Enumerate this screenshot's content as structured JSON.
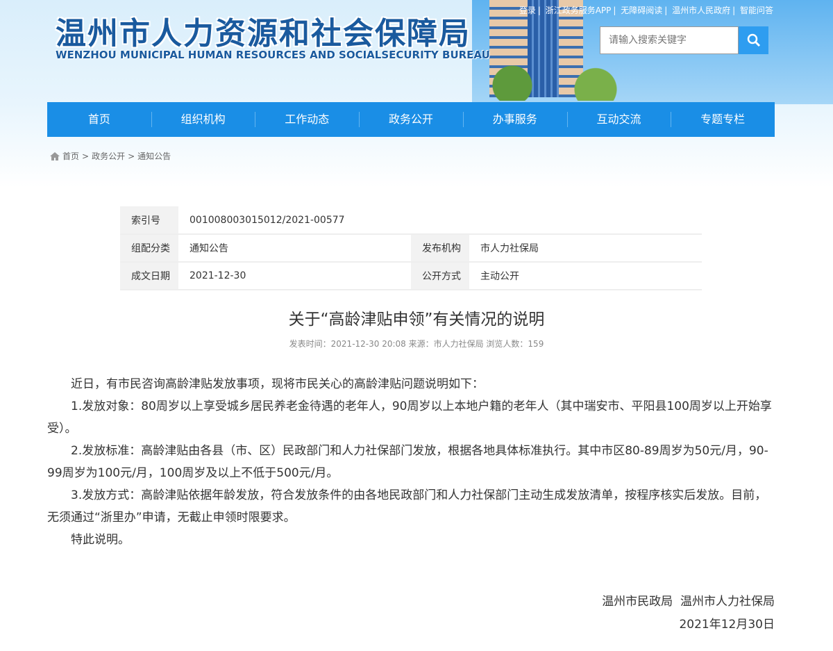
{
  "header": {
    "title_cn": "温州市人力资源和社会保障局",
    "title_en": "WENZHOU MUNICIPAL HUMAN RESOURCES AND SOCIALSECURITY BUREAU",
    "top_links": [
      "登录",
      "浙江政务服务APP",
      "无障碍阅读",
      "温州市人民政府",
      "智能问答"
    ],
    "search_placeholder": "请输入搜索关键字"
  },
  "nav": [
    "首页",
    "组织机构",
    "工作动态",
    "政务公开",
    "办事服务",
    "互动交流",
    "专题专栏"
  ],
  "breadcrumb": [
    "首页",
    "政务公开",
    "通知公告"
  ],
  "info": {
    "index_label": "索引号",
    "index_value": "001008003015012/2021-00577",
    "category_label": "组配分类",
    "category_value": "通知公告",
    "publisher_label": "发布机构",
    "publisher_value": "市人力社保局",
    "date_label": "成文日期",
    "date_value": "2021-12-30",
    "mode_label": "公开方式",
    "mode_value": "主动公开"
  },
  "article": {
    "title": "关于“高龄津贴申领”有关情况的说明",
    "meta": "发表时间：2021-12-30 20:08 来源：市人力社保局 浏览人数：159",
    "paragraphs": [
      "近日，有市民咨询高龄津贴发放事项，现将市民关心的高龄津贴问题说明如下：",
      "1.发放对象：80周岁以上享受城乡居民养老金待遇的老年人，90周岁以上本地户籍的老年人（其中瑞安市、平阳县100周岁以上开始享受）。",
      "2.发放标准：高龄津贴由各县（市、区）民政部门和人力社保部门发放，根据各地具体标准执行。其中市区80-89周岁为50元/月，90-99周岁为100元/月，100周岁及以上不低于500元/月。",
      "3.发放方式：高龄津贴依据年龄发放，符合发放条件的由各地民政部门和人力社保部门主动生成发放清单，按程序核实后发放。目前，无须通过“浙里办”申请，无截止申领时限要求。",
      "特此说明。"
    ],
    "signature": "温州市民政局  温州市人力社保局",
    "sign_date": "2021年12月30日"
  }
}
